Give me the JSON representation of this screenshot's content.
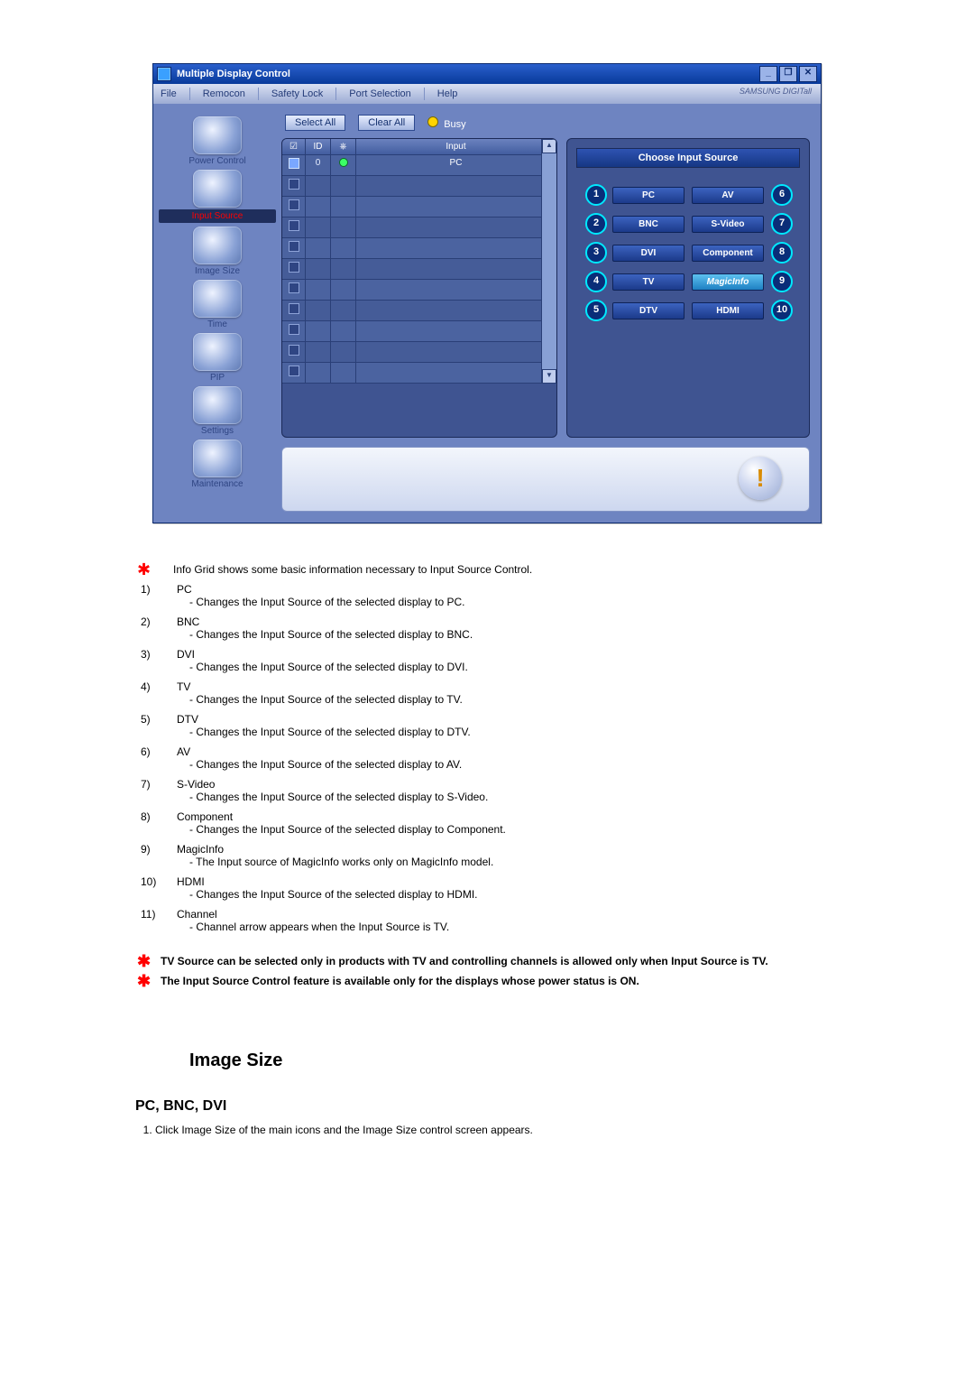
{
  "window": {
    "title": "Multiple Display Control",
    "min_glyph": "_",
    "max_glyph": "❐",
    "close_glyph": "✕"
  },
  "menu": {
    "file": "File",
    "remocon": "Remocon",
    "safety_lock": "Safety Lock",
    "port_selection": "Port Selection",
    "help": "Help",
    "brand": "SAMSUNG DIGITall"
  },
  "sidebar": {
    "power": "Power Control",
    "input": "Input Source",
    "image": "Image Size",
    "time": "Time",
    "pip": "PIP",
    "settings": "Settings",
    "maintenance": "Maintenance"
  },
  "toolbar": {
    "select_all": "Select All",
    "clear_all": "Clear All",
    "busy": "Busy"
  },
  "grid": {
    "headers": {
      "chk": "☑",
      "id": "ID",
      "status": "⎈",
      "input": "Input"
    },
    "row1": {
      "id": "0",
      "input": "PC"
    }
  },
  "source_panel": {
    "title": "Choose Input Source",
    "items": {
      "1": "PC",
      "2": "BNC",
      "3": "DVI",
      "4": "TV",
      "5": "DTV",
      "6": "AV",
      "7": "S-Video",
      "8": "Component",
      "9": "MagicInfo",
      "10": "HDMI"
    }
  },
  "footer_orb": "!",
  "notes": {
    "intro_star": "✱",
    "intro": "Info Grid shows some basic information necessary to Input Source Control.",
    "tv_note": "TV Source can be selected only in products with TV and controlling channels is allowed only when Input Source is TV.",
    "power_note": "The Input Source Control feature is available only for the displays whose power status is ON."
  },
  "items": [
    {
      "n": "1)",
      "t": "PC",
      "d": "- Changes the Input Source of the selected display to PC."
    },
    {
      "n": "2)",
      "t": "BNC",
      "d": "- Changes the Input Source of the selected display to BNC."
    },
    {
      "n": "3)",
      "t": "DVI",
      "d": "- Changes the Input Source of the selected display to DVI."
    },
    {
      "n": "4)",
      "t": "TV",
      "d": "- Changes the Input Source of the selected display to TV."
    },
    {
      "n": "5)",
      "t": "DTV",
      "d": "- Changes the Input Source of the selected display to DTV."
    },
    {
      "n": "6)",
      "t": "AV",
      "d": "- Changes the Input Source of the selected display to AV."
    },
    {
      "n": "7)",
      "t": "S-Video",
      "d": "- Changes the Input Source of the selected display to S-Video."
    },
    {
      "n": "8)",
      "t": "Component",
      "d": "- Changes the Input Source of the selected display to Component."
    },
    {
      "n": "9)",
      "t": "MagicInfo",
      "d": "- The Input source of MagicInfo works only on MagicInfo model."
    },
    {
      "n": "10)",
      "t": "HDMI",
      "d": "- Changes the Input Source of the selected display to HDMI."
    },
    {
      "n": "11)",
      "t": "Channel",
      "d": "- Channel arrow appears when the Input Source is TV."
    }
  ],
  "section_heading": "Image Size",
  "sub_heading": "PC, BNC, DVI",
  "sub_step": "Click Image Size of the main icons and the Image Size control screen appears."
}
